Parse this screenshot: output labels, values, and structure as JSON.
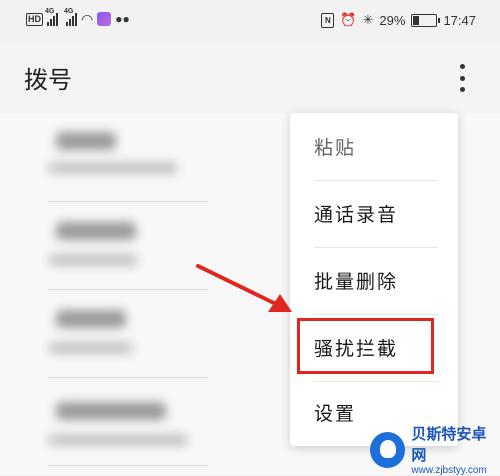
{
  "status_bar": {
    "hd_badge": "HD",
    "network1": "4G",
    "network2": "4G",
    "battery_percent": "29%",
    "battery_level": 0.29,
    "time": "17:47",
    "icons": [
      "hd-icon",
      "signal-icon",
      "signal-icon",
      "wifi-icon",
      "app-icon",
      "wechat-icon",
      "nfc-icon",
      "alarm-icon",
      "bluetooth-icon",
      "battery-icon"
    ]
  },
  "app_bar": {
    "title": "拨号",
    "more_icon": "more-vertical-icon"
  },
  "menu": {
    "items": [
      {
        "label": "粘贴"
      },
      {
        "label": "通话录音"
      },
      {
        "label": "批量删除"
      },
      {
        "label": "骚扰拦截"
      },
      {
        "label": "设置"
      }
    ]
  },
  "annotation": {
    "arrow_color": "#e0261f",
    "box_color": "#e0261f"
  },
  "watermark": {
    "name": "贝斯特安卓网",
    "url": "www.zjbstyy.com"
  }
}
